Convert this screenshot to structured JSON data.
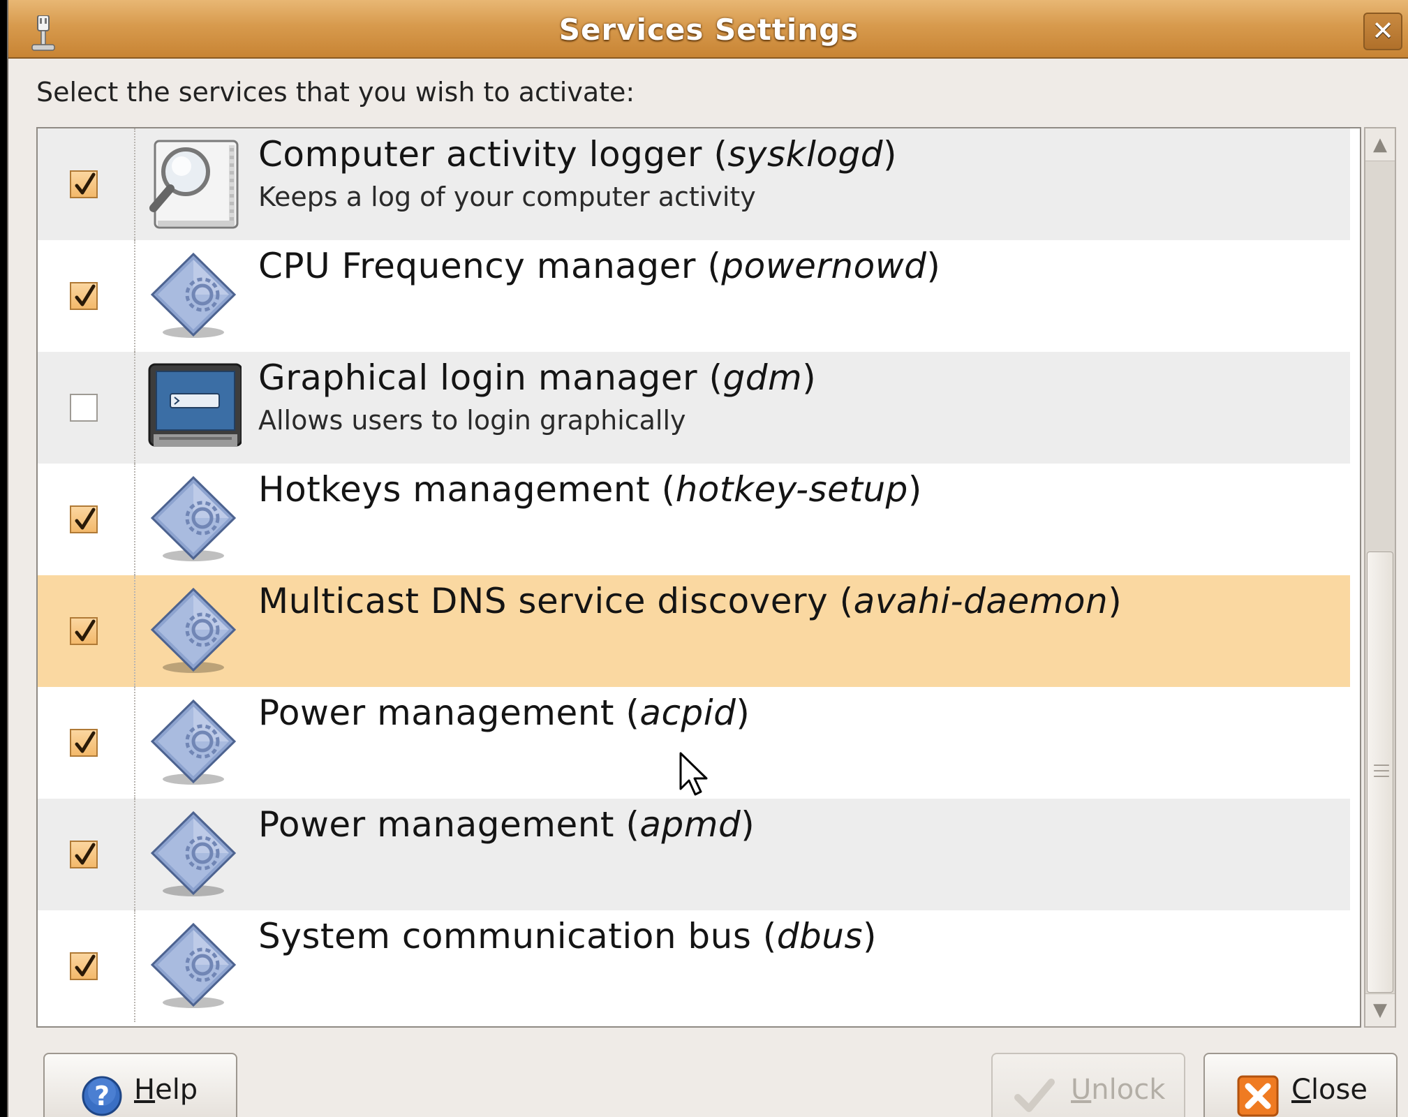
{
  "window": {
    "title": "Services Settings",
    "close_glyph": "✕"
  },
  "prompt": "Select the services that you wish to activate:",
  "services": [
    {
      "name": "Computer activity logger (",
      "daemon": "sysklogd",
      "suffix": ")",
      "description": "Keeps a log of your computer activity",
      "checked": true,
      "icon": "log-viewer-icon"
    },
    {
      "name": "CPU Frequency manager (",
      "daemon": "powernowd",
      "suffix": ")",
      "description": "",
      "checked": true,
      "icon": "service-gear-icon"
    },
    {
      "name": "Graphical login manager (",
      "daemon": "gdm",
      "suffix": ")",
      "description": "Allows users to login graphically",
      "checked": false,
      "icon": "login-screen-icon"
    },
    {
      "name": "Hotkeys management (",
      "daemon": "hotkey-setup",
      "suffix": ")",
      "description": "",
      "checked": true,
      "icon": "service-gear-icon"
    },
    {
      "name": "Multicast DNS service discovery (",
      "daemon": "avahi-daemon",
      "suffix": ")",
      "description": "",
      "checked": true,
      "icon": "service-gear-icon",
      "selected": true
    },
    {
      "name": "Power management (",
      "daemon": "acpid",
      "suffix": ")",
      "description": "",
      "checked": true,
      "icon": "service-gear-icon"
    },
    {
      "name": "Power management (",
      "daemon": "apmd",
      "suffix": ")",
      "description": "",
      "checked": true,
      "icon": "service-gear-icon"
    },
    {
      "name": "System communication bus (",
      "daemon": "dbus",
      "suffix": ")",
      "description": "",
      "checked": true,
      "icon": "service-gear-icon"
    }
  ],
  "buttons": {
    "help": {
      "mnemonic": "H",
      "rest": "elp"
    },
    "unlock": {
      "mnemonic": "U",
      "rest": "nlock"
    },
    "close": {
      "mnemonic": "C",
      "rest": "lose"
    }
  },
  "colors": {
    "titlebar": "#d79a4d",
    "selection": "#fad8a1",
    "checkbox_checked": "#f3b96b"
  }
}
